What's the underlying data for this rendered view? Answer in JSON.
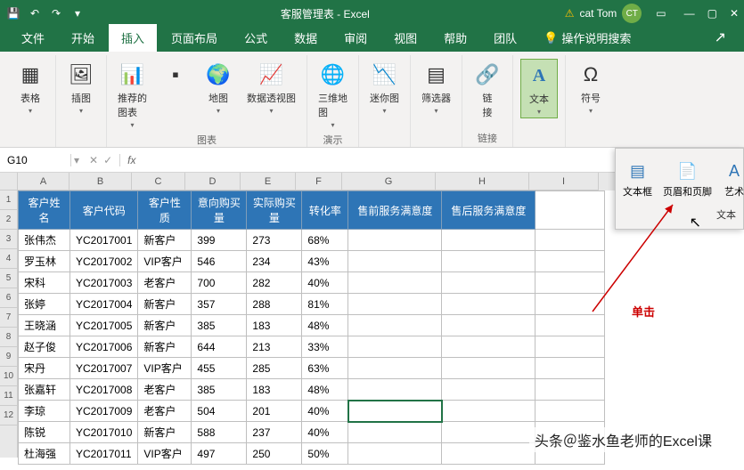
{
  "titlebar": {
    "title": "客服管理表 - Excel",
    "user": "cat Tom",
    "avatar": "CT",
    "warn_icon": "⚠"
  },
  "tabs": [
    "文件",
    "开始",
    "插入",
    "页面布局",
    "公式",
    "数据",
    "审阅",
    "视图",
    "帮助",
    "团队"
  ],
  "tab_search": "操作说明搜索",
  "active_tab": 2,
  "ribbon": {
    "groups": [
      {
        "label": "",
        "items": [
          {
            "name": "tables",
            "text": "表格",
            "dd": true
          }
        ]
      },
      {
        "label": "",
        "items": [
          {
            "name": "illustrations",
            "text": "插图",
            "dd": true
          }
        ]
      },
      {
        "label": "图表",
        "items": [
          {
            "name": "rec-charts",
            "text": "推荐的\n图表",
            "dd": true
          },
          {
            "name": "charts",
            "text": "",
            "mini": true
          },
          {
            "name": "maps",
            "text": "地图",
            "dd": true
          },
          {
            "name": "pivotchart",
            "text": "数据透视图",
            "dd": true
          }
        ]
      },
      {
        "label": "演示",
        "items": [
          {
            "name": "3dmap",
            "text": "三维地\n图",
            "dd": true
          }
        ]
      },
      {
        "label": "",
        "items": [
          {
            "name": "sparklines",
            "text": "迷你图",
            "dd": true
          }
        ]
      },
      {
        "label": "",
        "items": [
          {
            "name": "filters",
            "text": "筛选器",
            "dd": true
          }
        ]
      },
      {
        "label": "链接",
        "items": [
          {
            "name": "links",
            "text": "链\n接"
          }
        ]
      },
      {
        "label": "",
        "items": [
          {
            "name": "text",
            "text": "文本",
            "dd": true,
            "active": true
          }
        ]
      },
      {
        "label": "",
        "items": [
          {
            "name": "symbols",
            "text": "符号",
            "dd": true
          }
        ]
      }
    ]
  },
  "namebox": "G10",
  "fx": "",
  "columns": [
    "A",
    "B",
    "C",
    "D",
    "E",
    "F",
    "G",
    "H",
    "I"
  ],
  "headers": [
    "客户姓名",
    "客户代码",
    "客户性质",
    "意向购买量",
    "实际购买量",
    "转化率",
    "售前服务满意度",
    "售后服务满意度",
    ""
  ],
  "rows": [
    [
      "张伟杰",
      "YC2017001",
      "新客户",
      "399",
      "273",
      "68%",
      "",
      "",
      ""
    ],
    [
      "罗玉林",
      "YC2017002",
      "VIP客户",
      "546",
      "234",
      "43%",
      "",
      "",
      ""
    ],
    [
      "宋科",
      "YC2017003",
      "老客户",
      "700",
      "282",
      "40%",
      "",
      "",
      ""
    ],
    [
      "张婷",
      "YC2017004",
      "新客户",
      "357",
      "288",
      "81%",
      "",
      "",
      ""
    ],
    [
      "王晓涵",
      "YC2017005",
      "新客户",
      "385",
      "183",
      "48%",
      "",
      "",
      ""
    ],
    [
      "赵子俊",
      "YC2017006",
      "新客户",
      "644",
      "213",
      "33%",
      "",
      "",
      ""
    ],
    [
      "宋丹",
      "YC2017007",
      "VIP客户",
      "455",
      "285",
      "63%",
      "",
      "",
      ""
    ],
    [
      "张嘉轩",
      "YC2017008",
      "老客户",
      "385",
      "183",
      "48%",
      "",
      "",
      ""
    ],
    [
      "李琼",
      "YC2017009",
      "老客户",
      "504",
      "201",
      "40%",
      "",
      "",
      ""
    ],
    [
      "陈锐",
      "YC2017010",
      "新客户",
      "588",
      "237",
      "40%",
      "",
      "",
      ""
    ],
    [
      "杜海强",
      "YC2017011",
      "VIP客户",
      "497",
      "250",
      "50%",
      "",
      "",
      ""
    ]
  ],
  "selected": {
    "row": 9,
    "col": 6
  },
  "dropdown": {
    "items": [
      "文本框",
      "页眉和页脚",
      "艺术"
    ],
    "label_row2": "文本"
  },
  "annotation": "单击",
  "watermark": "头条＠鉴水鱼老师的Excel课"
}
